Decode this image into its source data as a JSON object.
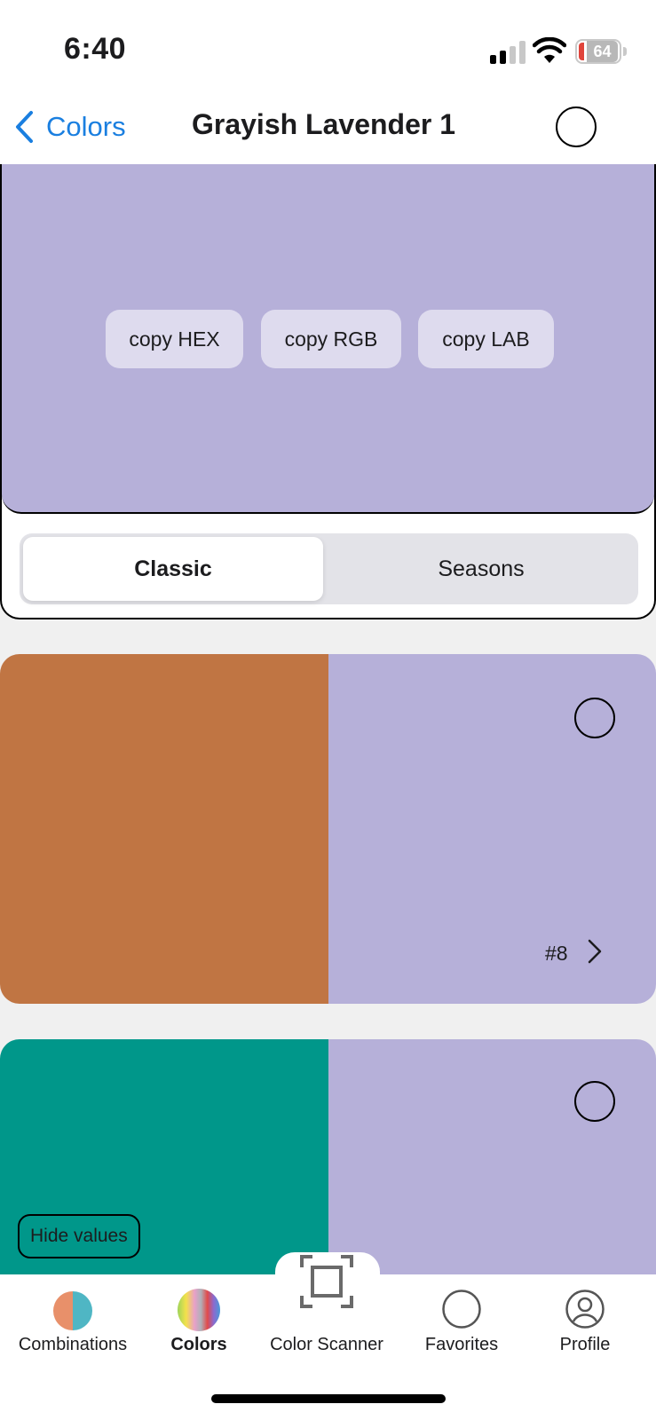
{
  "status_bar": {
    "time": "6:40",
    "battery": "64",
    "battery_low_color": "#e0443b"
  },
  "nav": {
    "back_label": "Colors",
    "title": "Grayish Lavender 1",
    "back_icon": "chevron-left-icon",
    "favorite_icon": "circle-outline-icon",
    "accent_color": "#1a7fe0"
  },
  "header": {
    "swatch_color": "#b6b0d9",
    "copy_buttons": [
      "copy HEX",
      "copy RGB",
      "copy LAB"
    ]
  },
  "segmented_control": {
    "options": [
      "Classic",
      "Seasons"
    ],
    "selected": "Classic"
  },
  "combinations": [
    {
      "left_color": "#c07543",
      "right_color": "#b6b0d9",
      "number": "#8",
      "favorite_icon": "circle-outline-icon",
      "chevron_icon": "chevron-right-icon"
    },
    {
      "left_color": "#00978a",
      "right_color": "#b6b0d9",
      "favorite_icon": "circle-outline-icon"
    }
  ],
  "hide_values_label": "Hide values",
  "tab_bar": {
    "tabs": [
      {
        "label": "Combinations",
        "icon": "combinations-icon"
      },
      {
        "label": "Colors",
        "icon": "colors-icon",
        "selected": true
      },
      {
        "label": "Color Scanner",
        "icon": "scanner-icon"
      },
      {
        "label": "Favorites",
        "icon": "favorites-circle-icon"
      },
      {
        "label": "Profile",
        "icon": "profile-icon"
      }
    ]
  }
}
